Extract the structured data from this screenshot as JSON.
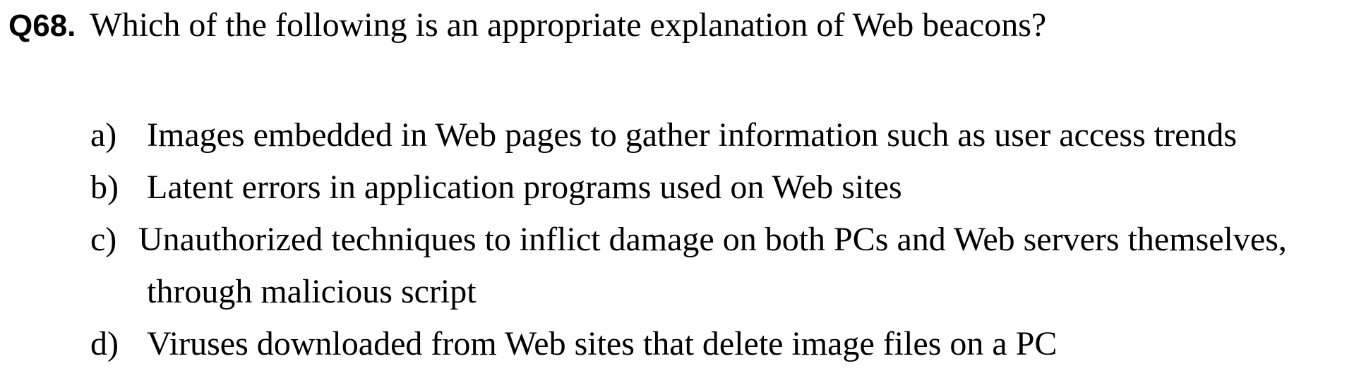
{
  "question": {
    "number": "Q68.",
    "text": "Which of the following is an appropriate explanation of Web beacons?"
  },
  "options": [
    {
      "letter": "a)",
      "text": "Images embedded in Web pages to gather information such as user access trends"
    },
    {
      "letter": "b)",
      "text": "Latent errors in application programs used on Web sites"
    },
    {
      "letter": "c)",
      "text": "Unauthorized techniques to inflict damage on both PCs and Web servers themselves,",
      "continuation": "through malicious script"
    },
    {
      "letter": "d)",
      "text": "Viruses downloaded from Web sites that delete image files on a PC"
    }
  ]
}
